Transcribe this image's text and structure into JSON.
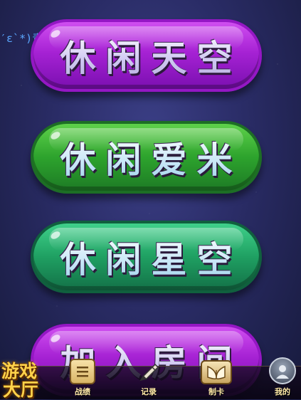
{
  "top_text": "′ε`*)青",
  "menu": {
    "items": [
      {
        "label": "休闲天空",
        "color": "#a622d4"
      },
      {
        "label": "休闲爱米",
        "color": "#2da32d"
      },
      {
        "label": "休闲星空",
        "color": "#1fa062"
      },
      {
        "label": "加入房间",
        "color": "#a622d4"
      }
    ]
  },
  "logo": {
    "line1": "游戏",
    "line2": "大厅"
  },
  "nav": {
    "items": [
      {
        "label": "战绩",
        "icon": "scroll-icon"
      },
      {
        "label": "记录",
        "icon": "pen-icon"
      },
      {
        "label": "制卡",
        "icon": "card-book-icon"
      },
      {
        "label": "我的",
        "icon": "avatar-icon"
      }
    ]
  }
}
